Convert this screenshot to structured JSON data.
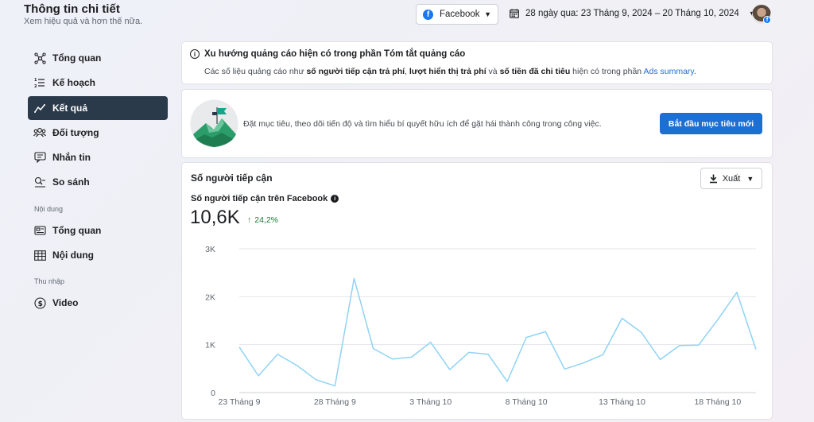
{
  "header": {
    "title": "Thông tin chi tiết",
    "subtitle": "Xem hiệu quả và hơn thế nữa.",
    "platform": "Facebook",
    "date_range": "28 ngày qua: 23 Tháng 9, 2024 – 20 Tháng 10, 2024"
  },
  "sidebar": {
    "items": [
      {
        "label": "Tổng quan",
        "icon": "network-icon"
      },
      {
        "label": "Kế hoạch",
        "icon": "list-icon"
      },
      {
        "label": "Kết quả",
        "icon": "trend-icon",
        "active": true
      },
      {
        "label": "Đối tượng",
        "icon": "people-icon"
      },
      {
        "label": "Nhắn tin",
        "icon": "message-icon"
      },
      {
        "label": "So sánh",
        "icon": "compare-icon"
      }
    ],
    "section_content": "Nội dung",
    "content_items": [
      {
        "label": "Tổng quan",
        "icon": "content-overview-icon"
      },
      {
        "label": "Nội dung",
        "icon": "table-icon"
      }
    ],
    "section_income": "Thu nhập",
    "income_items": [
      {
        "label": "Video",
        "icon": "dollar-icon"
      }
    ]
  },
  "notice": {
    "title": "Xu hướng quảng cáo hiện có trong phần Tóm tắt quảng cáo",
    "body_prefix": "Các số liệu quảng cáo như ",
    "body_bold1": "số người tiếp cận trả phí",
    "body_sep1": ", ",
    "body_bold2": "lượt hiển thị trả phí",
    "body_sep2": " và ",
    "body_bold3": "số tiền đã chi tiêu",
    "body_suffix": " hiện có trong phần ",
    "link": "Ads summary",
    "body_end": "."
  },
  "goal": {
    "text": "Đặt mục tiêu, theo dõi tiến độ và tìm hiểu bí quyết hữu ích để gặt hái thành công trong công việc.",
    "button": "Bắt đầu mục tiêu mới"
  },
  "reach": {
    "title": "Số người tiếp cận",
    "export": "Xuất",
    "metric_label": "Số người tiếp cận trên Facebook",
    "metric_value": "10,6K",
    "metric_change": "24,2%"
  },
  "colors": {
    "accent": "#1d6fd1",
    "line": "#8fd3f4",
    "positive": "#1e7d39",
    "active_nav": "#2b3a4a"
  },
  "chart_data": {
    "type": "line",
    "x": [
      "23 Tháng 9",
      "24 Tháng 9",
      "25 Tháng 9",
      "26 Tháng 9",
      "27 Tháng 9",
      "28 Tháng 9",
      "29 Tháng 9",
      "30 Tháng 9",
      "1 Tháng 10",
      "2 Tháng 10",
      "3 Tháng 10",
      "4 Tháng 10",
      "5 Tháng 10",
      "6 Tháng 10",
      "7 Tháng 10",
      "8 Tháng 10",
      "9 Tháng 10",
      "10 Tháng 10",
      "11 Tháng 10",
      "12 Tháng 10",
      "13 Tháng 10",
      "14 Tháng 10",
      "15 Tháng 10",
      "16 Tháng 10",
      "17 Tháng 10",
      "18 Tháng 10",
      "19 Tháng 10",
      "20 Tháng 10"
    ],
    "xticks": [
      "23 Tháng 9",
      "28 Tháng 9",
      "3 Tháng 10",
      "8 Tháng 10",
      "13 Tháng 10",
      "18 Tháng 10"
    ],
    "values": [
      950,
      350,
      800,
      570,
      270,
      140,
      2380,
      920,
      700,
      740,
      1050,
      480,
      840,
      800,
      230,
      1150,
      1270,
      490,
      620,
      790,
      1550,
      1260,
      690,
      980,
      990,
      1520,
      2090,
      900
    ],
    "ylim": [
      0,
      3000
    ],
    "yticks": [
      "0",
      "1K",
      "2K",
      "3K"
    ],
    "grid": true
  }
}
